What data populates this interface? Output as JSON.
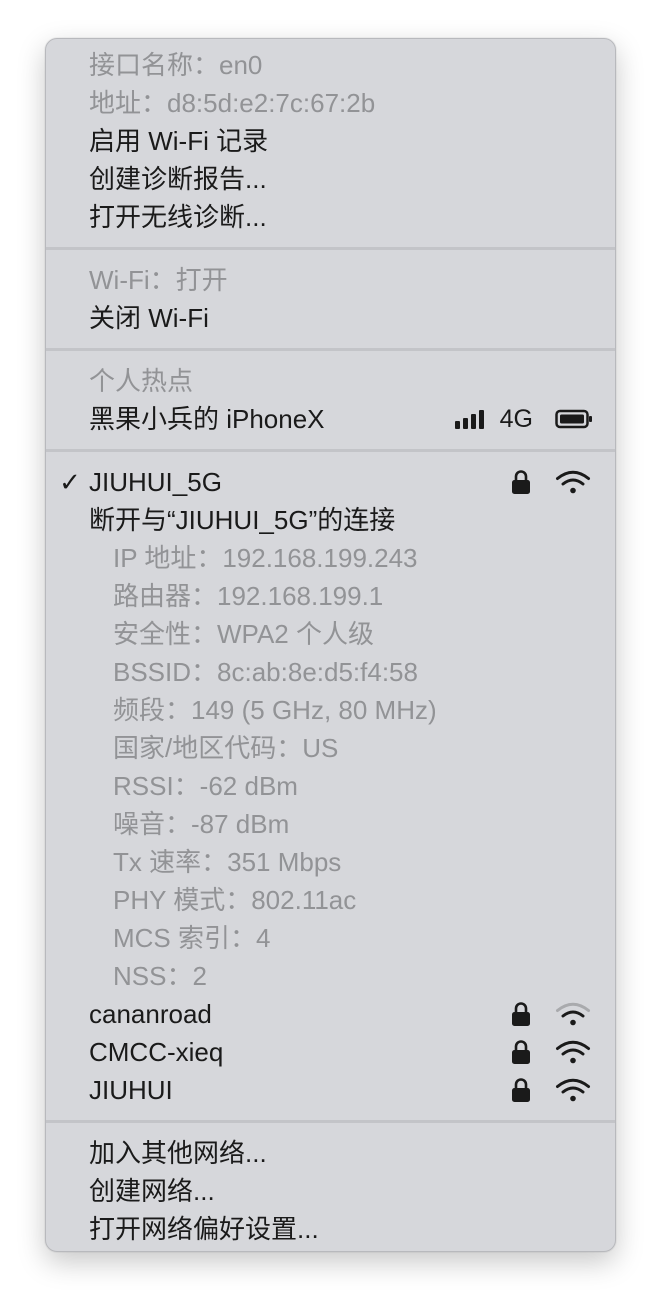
{
  "interface": {
    "name": "接口名称：en0",
    "address": "地址：d8:5d:e2:7c:67:2b",
    "enable_logging": "启用 Wi-Fi 记录",
    "create_report": "创建诊断报告...",
    "open_diagnostics": "打开无线诊断..."
  },
  "wifi": {
    "status": "Wi-Fi：打开",
    "toggle": "关闭 Wi-Fi"
  },
  "hotspot": {
    "header": "个人热点",
    "device": "黑果小兵的 iPhoneX",
    "network_type": "4G"
  },
  "current": {
    "ssid": "JIUHUI_5G",
    "check": "✓",
    "disconnect": "断开与“JIUHUI_5G”的连接",
    "details": [
      "IP 地址：192.168.199.243",
      "路由器：192.168.199.1",
      "安全性：WPA2 个人级",
      "BSSID：8c:ab:8e:d5:f4:58",
      "频段：149 (5 GHz, 80 MHz)",
      "国家/地区代码：US",
      "RSSI：-62 dBm",
      "噪音：-87 dBm",
      "Tx 速率：351 Mbps",
      "PHY 模式：802.11ac",
      "MCS 索引：4",
      "NSS：2"
    ]
  },
  "networks": [
    {
      "ssid": "cananroad",
      "signal": 0.5
    },
    {
      "ssid": "CMCC-xieq",
      "signal": 1.0
    },
    {
      "ssid": "JIUHUI",
      "signal": 1.0
    }
  ],
  "actions": {
    "join_other": "加入其他网络...",
    "create_network": "创建网络...",
    "open_prefs": "打开网络偏好设置..."
  }
}
